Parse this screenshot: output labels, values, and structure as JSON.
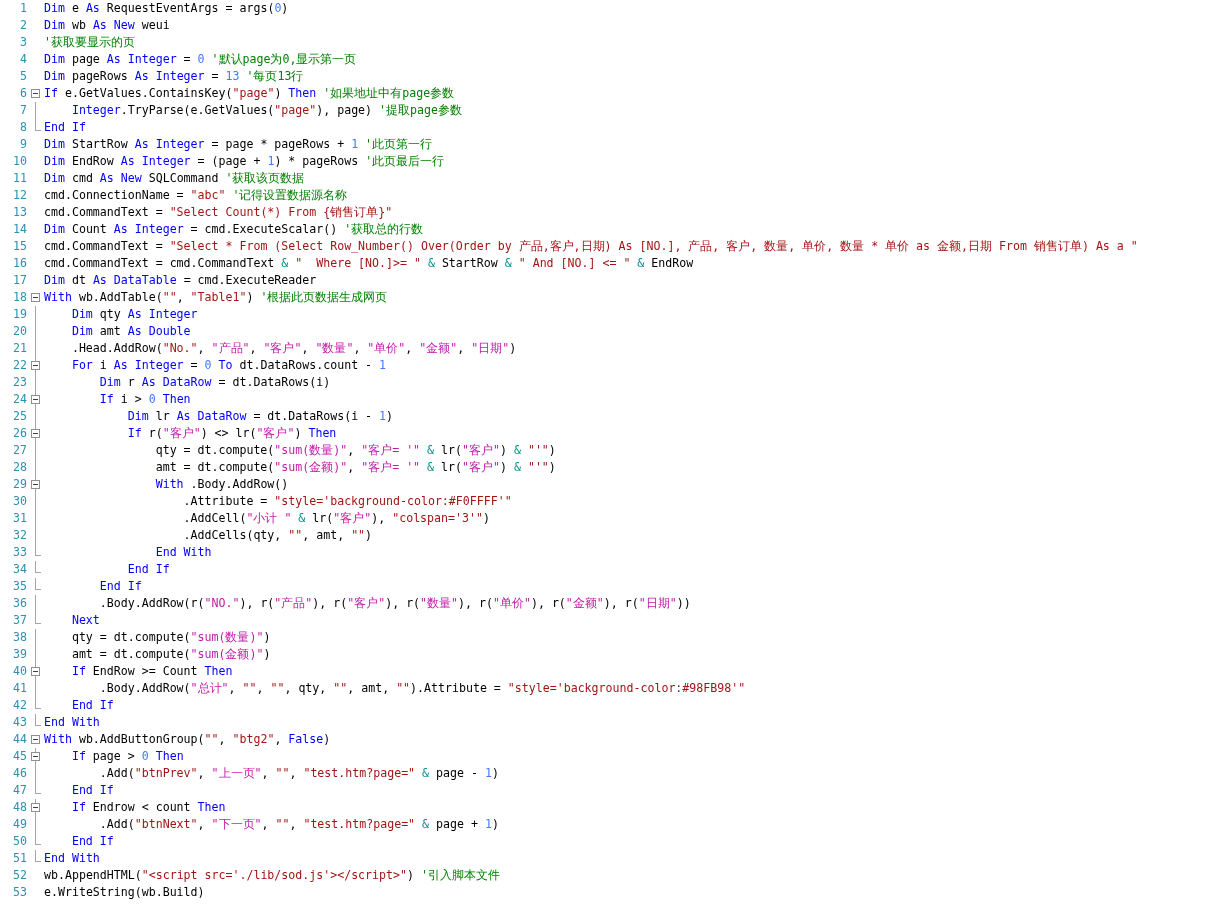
{
  "editor": {
    "lines": [
      {
        "number": "1",
        "tokens": [
          {
            "kind": "keyword",
            "text": "Dim "
          },
          {
            "kind": "plain",
            "text": "e "
          },
          {
            "kind": "keyword",
            "text": "As "
          },
          {
            "kind": "plain",
            "text": "RequestEventArgs = args("
          },
          {
            "kind": "number",
            "text": "0"
          },
          {
            "kind": "plain",
            "text": ")"
          }
        ]
      },
      {
        "number": "2",
        "tokens": [
          {
            "kind": "keyword",
            "text": "Dim "
          },
          {
            "kind": "plain",
            "text": "wb "
          },
          {
            "kind": "keyword",
            "text": "As New "
          },
          {
            "kind": "plain",
            "text": "weui"
          }
        ]
      },
      {
        "number": "3",
        "tokens": [
          {
            "kind": "comment",
            "text": "'获取要显示的页"
          }
        ]
      },
      {
        "number": "4",
        "tokens": [
          {
            "kind": "keyword",
            "text": "Dim "
          },
          {
            "kind": "plain",
            "text": "page "
          },
          {
            "kind": "keyword",
            "text": "As Integer "
          },
          {
            "kind": "plain",
            "text": "= "
          },
          {
            "kind": "number",
            "text": "0 "
          },
          {
            "kind": "comment",
            "text": "'默认page为0,显示第一页"
          }
        ]
      },
      {
        "number": "5",
        "tokens": [
          {
            "kind": "keyword",
            "text": "Dim "
          },
          {
            "kind": "plain",
            "text": "pageRows "
          },
          {
            "kind": "keyword",
            "text": "As Integer "
          },
          {
            "kind": "plain",
            "text": "= "
          },
          {
            "kind": "number",
            "text": "13 "
          },
          {
            "kind": "comment",
            "text": "'每页13行"
          }
        ]
      },
      {
        "number": "6",
        "tokens": [
          {
            "kind": "keyword",
            "text": "If "
          },
          {
            "kind": "plain",
            "text": "e.GetValues.ContainsKey("
          },
          {
            "kind": "string",
            "text": "\"page\""
          },
          {
            "kind": "plain",
            "text": ") "
          },
          {
            "kind": "keyword",
            "text": "Then "
          },
          {
            "kind": "comment",
            "text": "'如果地址中有page参数"
          }
        ],
        "children": [
          {
            "number": "7",
            "tokens": [
              {
                "kind": "keyword",
                "text": "Integer"
              },
              {
                "kind": "plain",
                "text": ".TryParse(e.GetValues("
              },
              {
                "kind": "string",
                "text": "\"page\""
              },
              {
                "kind": "plain",
                "text": "), page) "
              },
              {
                "kind": "comment",
                "text": "'提取page参数"
              }
            ]
          }
        ]
      },
      {
        "number": "8",
        "tokens": [
          {
            "kind": "keyword",
            "text": "End If"
          }
        ]
      },
      {
        "number": "9",
        "tokens": [
          {
            "kind": "keyword",
            "text": "Dim "
          },
          {
            "kind": "plain",
            "text": "StartRow "
          },
          {
            "kind": "keyword",
            "text": "As Integer "
          },
          {
            "kind": "plain",
            "text": "= page * pageRows + "
          },
          {
            "kind": "number",
            "text": "1 "
          },
          {
            "kind": "comment",
            "text": "'此页第一行"
          }
        ]
      },
      {
        "number": "10",
        "tokens": [
          {
            "kind": "keyword",
            "text": "Dim "
          },
          {
            "kind": "plain",
            "text": "EndRow "
          },
          {
            "kind": "keyword",
            "text": "As Integer "
          },
          {
            "kind": "plain",
            "text": "= (page + "
          },
          {
            "kind": "number",
            "text": "1"
          },
          {
            "kind": "plain",
            "text": ") * pageRows "
          },
          {
            "kind": "comment",
            "text": "'此页最后一行"
          }
        ]
      },
      {
        "number": "11",
        "tokens": [
          {
            "kind": "keyword",
            "text": "Dim "
          },
          {
            "kind": "plain",
            "text": "cmd "
          },
          {
            "kind": "keyword",
            "text": "As New "
          },
          {
            "kind": "plain",
            "text": "SQLCommand "
          },
          {
            "kind": "comment",
            "text": "'获取该页数据"
          }
        ]
      },
      {
        "number": "12",
        "tokens": [
          {
            "kind": "plain",
            "text": "cmd.ConnectionName = "
          },
          {
            "kind": "string",
            "text": "\"abc\" "
          },
          {
            "kind": "comment",
            "text": "'记得设置数据源名称"
          }
        ]
      },
      {
        "number": "13",
        "tokens": [
          {
            "kind": "plain",
            "text": "cmd.CommandText = "
          },
          {
            "kind": "string",
            "text": "\"Select Count(*) From {销售订单}\""
          }
        ]
      },
      {
        "number": "14",
        "tokens": [
          {
            "kind": "keyword",
            "text": "Dim "
          },
          {
            "kind": "plain",
            "text": "Count "
          },
          {
            "kind": "keyword",
            "text": "As Integer "
          },
          {
            "kind": "plain",
            "text": "= cmd.ExecuteScalar() "
          },
          {
            "kind": "comment",
            "text": "'获取总的行数"
          }
        ]
      },
      {
        "number": "15",
        "tokens": [
          {
            "kind": "plain",
            "text": "cmd.CommandText = "
          },
          {
            "kind": "string",
            "text": "\"Select * From (Select Row_Number() Over(Order by 产品,客户,日期) As [NO.], 产品, 客户, 数量, 单价, 数量 * 单价 as 金额,日期 From 销售订单) As a \""
          }
        ]
      },
      {
        "number": "16",
        "tokens": [
          {
            "kind": "plain",
            "text": "cmd.CommandText = cmd.CommandText "
          },
          {
            "kind": "operator",
            "text": "& "
          },
          {
            "kind": "string",
            "text": "\"  Where [NO.]>= \" "
          },
          {
            "kind": "operator",
            "text": "& "
          },
          {
            "kind": "plain",
            "text": "StartRow "
          },
          {
            "kind": "operator",
            "text": "& "
          },
          {
            "kind": "string",
            "text": "\" And [NO.] <= \" "
          },
          {
            "kind": "operator",
            "text": "& "
          },
          {
            "kind": "plain",
            "text": "EndRow"
          }
        ]
      },
      {
        "number": "17",
        "tokens": [
          {
            "kind": "keyword",
            "text": "Dim "
          },
          {
            "kind": "plain",
            "text": "dt "
          },
          {
            "kind": "keyword",
            "text": "As DataTable "
          },
          {
            "kind": "plain",
            "text": "= cmd.ExecuteReader"
          }
        ]
      },
      {
        "number": "18",
        "tokens": [
          {
            "kind": "keyword",
            "text": "With "
          },
          {
            "kind": "plain",
            "text": "wb.AddTable("
          },
          {
            "kind": "string",
            "text": "\"\""
          },
          {
            "kind": "plain",
            "text": ", "
          },
          {
            "kind": "string",
            "text": "\"Table1\""
          },
          {
            "kind": "plain",
            "text": ") "
          },
          {
            "kind": "comment",
            "text": "'根据此页数据生成网页"
          }
        ],
        "children": [
          {
            "number": "19",
            "tokens": [
              {
                "kind": "keyword",
                "text": "Dim "
              },
              {
                "kind": "plain",
                "text": "qty "
              },
              {
                "kind": "keyword",
                "text": "As Integer"
              }
            ]
          },
          {
            "number": "20",
            "tokens": [
              {
                "kind": "keyword",
                "text": "Dim "
              },
              {
                "kind": "plain",
                "text": "amt "
              },
              {
                "kind": "keyword",
                "text": "As Double"
              }
            ]
          },
          {
            "number": "21",
            "tokens": [
              {
                "kind": "plain",
                "text": ".Head.AddRow("
              },
              {
                "kind": "string",
                "text": "\"No.\""
              },
              {
                "kind": "plain",
                "text": ", "
              },
              {
                "kind": "literal",
                "text": "\"产品\""
              },
              {
                "kind": "plain",
                "text": ", "
              },
              {
                "kind": "literal",
                "text": "\"客户\""
              },
              {
                "kind": "plain",
                "text": ", "
              },
              {
                "kind": "literal",
                "text": "\"数量\""
              },
              {
                "kind": "plain",
                "text": ", "
              },
              {
                "kind": "literal",
                "text": "\"单价\""
              },
              {
                "kind": "plain",
                "text": ", "
              },
              {
                "kind": "literal",
                "text": "\"金额\""
              },
              {
                "kind": "plain",
                "text": ", "
              },
              {
                "kind": "literal",
                "text": "\"日期\""
              },
              {
                "kind": "plain",
                "text": ")"
              }
            ]
          },
          {
            "number": "22",
            "tokens": [
              {
                "kind": "keyword",
                "text": "For "
              },
              {
                "kind": "plain",
                "text": "i "
              },
              {
                "kind": "keyword",
                "text": "As Integer "
              },
              {
                "kind": "plain",
                "text": "= "
              },
              {
                "kind": "number",
                "text": "0 "
              },
              {
                "kind": "keyword",
                "text": "To "
              },
              {
                "kind": "plain",
                "text": "dt.DataRows.count - "
              },
              {
                "kind": "number",
                "text": "1"
              }
            ],
            "children": [
              {
                "number": "23",
                "tokens": [
                  {
                    "kind": "keyword",
                    "text": "Dim "
                  },
                  {
                    "kind": "plain",
                    "text": "r "
                  },
                  {
                    "kind": "keyword",
                    "text": "As DataRow "
                  },
                  {
                    "kind": "plain",
                    "text": "= dt.DataRows(i)"
                  }
                ]
              },
              {
                "number": "24",
                "tokens": [
                  {
                    "kind": "keyword",
                    "text": "If "
                  },
                  {
                    "kind": "plain",
                    "text": "i > "
                  },
                  {
                    "kind": "number",
                    "text": "0 "
                  },
                  {
                    "kind": "keyword",
                    "text": "Then"
                  }
                ],
                "children": [
                  {
                    "number": "25",
                    "tokens": [
                      {
                        "kind": "keyword",
                        "text": "Dim "
                      },
                      {
                        "kind": "plain",
                        "text": "lr "
                      },
                      {
                        "kind": "keyword",
                        "text": "As DataRow "
                      },
                      {
                        "kind": "plain",
                        "text": "= dt.DataRows(i - "
                      },
                      {
                        "kind": "number",
                        "text": "1"
                      },
                      {
                        "kind": "plain",
                        "text": ")"
                      }
                    ]
                  },
                  {
                    "number": "26",
                    "tokens": [
                      {
                        "kind": "keyword",
                        "text": "If "
                      },
                      {
                        "kind": "plain",
                        "text": "r("
                      },
                      {
                        "kind": "literal",
                        "text": "\"客户\""
                      },
                      {
                        "kind": "plain",
                        "text": ") <> lr("
                      },
                      {
                        "kind": "literal",
                        "text": "\"客户\""
                      },
                      {
                        "kind": "plain",
                        "text": ") "
                      },
                      {
                        "kind": "keyword",
                        "text": "Then"
                      }
                    ],
                    "children": [
                      {
                        "number": "27",
                        "tokens": [
                          {
                            "kind": "plain",
                            "text": "qty = dt.compute("
                          },
                          {
                            "kind": "literal",
                            "text": "\"sum(数量)\""
                          },
                          {
                            "kind": "plain",
                            "text": ", "
                          },
                          {
                            "kind": "literal",
                            "text": "\"客户= '\" "
                          },
                          {
                            "kind": "operator",
                            "text": "& "
                          },
                          {
                            "kind": "plain",
                            "text": "lr("
                          },
                          {
                            "kind": "literal",
                            "text": "\"客户\""
                          },
                          {
                            "kind": "plain",
                            "text": ") "
                          },
                          {
                            "kind": "operator",
                            "text": "& "
                          },
                          {
                            "kind": "string",
                            "text": "\"'\""
                          },
                          {
                            "kind": "plain",
                            "text": ")"
                          }
                        ]
                      },
                      {
                        "number": "28",
                        "tokens": [
                          {
                            "kind": "plain",
                            "text": "amt = dt.compute("
                          },
                          {
                            "kind": "literal",
                            "text": "\"sum(金额)\""
                          },
                          {
                            "kind": "plain",
                            "text": ", "
                          },
                          {
                            "kind": "literal",
                            "text": "\"客户= '\" "
                          },
                          {
                            "kind": "operator",
                            "text": "& "
                          },
                          {
                            "kind": "plain",
                            "text": "lr("
                          },
                          {
                            "kind": "literal",
                            "text": "\"客户\""
                          },
                          {
                            "kind": "plain",
                            "text": ") "
                          },
                          {
                            "kind": "operator",
                            "text": "& "
                          },
                          {
                            "kind": "string",
                            "text": "\"'\""
                          },
                          {
                            "kind": "plain",
                            "text": ")"
                          }
                        ]
                      },
                      {
                        "number": "29",
                        "tokens": [
                          {
                            "kind": "keyword",
                            "text": "With "
                          },
                          {
                            "kind": "plain",
                            "text": ".Body.AddRow()"
                          }
                        ],
                        "children": [
                          {
                            "number": "30",
                            "tokens": [
                              {
                                "kind": "plain",
                                "text": ".Attribute = "
                              },
                              {
                                "kind": "string",
                                "text": "\"style='background-color:#F0FFFF'\""
                              }
                            ]
                          },
                          {
                            "number": "31",
                            "tokens": [
                              {
                                "kind": "plain",
                                "text": ".AddCell("
                              },
                              {
                                "kind": "literal",
                                "text": "\"小计 \" "
                              },
                              {
                                "kind": "operator",
                                "text": "& "
                              },
                              {
                                "kind": "plain",
                                "text": "lr("
                              },
                              {
                                "kind": "literal",
                                "text": "\"客户\""
                              },
                              {
                                "kind": "plain",
                                "text": "), "
                              },
                              {
                                "kind": "string",
                                "text": "\"colspan='3'\""
                              },
                              {
                                "kind": "plain",
                                "text": ")"
                              }
                            ]
                          },
                          {
                            "number": "32",
                            "tokens": [
                              {
                                "kind": "plain",
                                "text": ".AddCells(qty, "
                              },
                              {
                                "kind": "string",
                                "text": "\"\""
                              },
                              {
                                "kind": "plain",
                                "text": ", amt, "
                              },
                              {
                                "kind": "string",
                                "text": "\"\""
                              },
                              {
                                "kind": "plain",
                                "text": ")"
                              }
                            ]
                          }
                        ]
                      },
                      {
                        "number": "33",
                        "tokens": [
                          {
                            "kind": "keyword",
                            "text": "End With"
                          }
                        ]
                      }
                    ]
                  },
                  {
                    "number": "34",
                    "tokens": [
                      {
                        "kind": "keyword",
                        "text": "End If"
                      }
                    ]
                  }
                ]
              },
              {
                "number": "35",
                "tokens": [
                  {
                    "kind": "keyword",
                    "text": "End If"
                  }
                ]
              },
              {
                "number": "36",
                "tokens": [
                  {
                    "kind": "plain",
                    "text": ".Body.AddRow(r("
                  },
                  {
                    "kind": "literal",
                    "text": "\"NO.\""
                  },
                  {
                    "kind": "plain",
                    "text": "), r("
                  },
                  {
                    "kind": "literal",
                    "text": "\"产品\""
                  },
                  {
                    "kind": "plain",
                    "text": "), r("
                  },
                  {
                    "kind": "literal",
                    "text": "\"客户\""
                  },
                  {
                    "kind": "plain",
                    "text": "), r("
                  },
                  {
                    "kind": "literal",
                    "text": "\"数量\""
                  },
                  {
                    "kind": "plain",
                    "text": "), r("
                  },
                  {
                    "kind": "literal",
                    "text": "\"单价\""
                  },
                  {
                    "kind": "plain",
                    "text": "), r("
                  },
                  {
                    "kind": "literal",
                    "text": "\"金额\""
                  },
                  {
                    "kind": "plain",
                    "text": "), r("
                  },
                  {
                    "kind": "literal",
                    "text": "\"日期\""
                  },
                  {
                    "kind": "plain",
                    "text": "))"
                  }
                ]
              }
            ]
          },
          {
            "number": "37",
            "tokens": [
              {
                "kind": "keyword",
                "text": "Next"
              }
            ]
          },
          {
            "number": "38",
            "tokens": [
              {
                "kind": "plain",
                "text": "qty = dt.compute("
              },
              {
                "kind": "literal",
                "text": "\"sum(数量)\""
              },
              {
                "kind": "plain",
                "text": ")"
              }
            ]
          },
          {
            "number": "39",
            "tokens": [
              {
                "kind": "plain",
                "text": "amt = dt.compute("
              },
              {
                "kind": "literal",
                "text": "\"sum(金额)\""
              },
              {
                "kind": "plain",
                "text": ")"
              }
            ]
          },
          {
            "number": "40",
            "tokens": [
              {
                "kind": "keyword",
                "text": "If "
              },
              {
                "kind": "plain",
                "text": "EndRow >= Count "
              },
              {
                "kind": "keyword",
                "text": "Then"
              }
            ],
            "children": [
              {
                "number": "41",
                "tokens": [
                  {
                    "kind": "plain",
                    "text": ".Body.AddRow("
                  },
                  {
                    "kind": "literal",
                    "text": "\"总计\""
                  },
                  {
                    "kind": "plain",
                    "text": ", "
                  },
                  {
                    "kind": "string",
                    "text": "\"\""
                  },
                  {
                    "kind": "plain",
                    "text": ", "
                  },
                  {
                    "kind": "string",
                    "text": "\"\""
                  },
                  {
                    "kind": "plain",
                    "text": ", qty, "
                  },
                  {
                    "kind": "string",
                    "text": "\"\""
                  },
                  {
                    "kind": "plain",
                    "text": ", amt, "
                  },
                  {
                    "kind": "string",
                    "text": "\"\""
                  },
                  {
                    "kind": "plain",
                    "text": ").Attribute = "
                  },
                  {
                    "kind": "string",
                    "text": "\"style='background-color:#98FB98'\""
                  }
                ]
              }
            ]
          },
          {
            "number": "42",
            "tokens": [
              {
                "kind": "keyword",
                "text": "End If"
              }
            ]
          }
        ]
      },
      {
        "number": "43",
        "tokens": [
          {
            "kind": "keyword",
            "text": "End With"
          }
        ]
      },
      {
        "number": "44",
        "tokens": [
          {
            "kind": "keyword",
            "text": "With "
          },
          {
            "kind": "plain",
            "text": "wb.AddButtonGroup("
          },
          {
            "kind": "string",
            "text": "\"\""
          },
          {
            "kind": "plain",
            "text": ", "
          },
          {
            "kind": "string",
            "text": "\"btg2\""
          },
          {
            "kind": "plain",
            "text": ", "
          },
          {
            "kind": "keyword",
            "text": "False"
          },
          {
            "kind": "plain",
            "text": ")"
          }
        ],
        "children": [
          {
            "number": "45",
            "tokens": [
              {
                "kind": "keyword",
                "text": "If "
              },
              {
                "kind": "plain",
                "text": "page > "
              },
              {
                "kind": "number",
                "text": "0 "
              },
              {
                "kind": "keyword",
                "text": "Then"
              }
            ],
            "children": [
              {
                "number": "46",
                "tokens": [
                  {
                    "kind": "plain",
                    "text": ".Add("
                  },
                  {
                    "kind": "string",
                    "text": "\"btnPrev\""
                  },
                  {
                    "kind": "plain",
                    "text": ", "
                  },
                  {
                    "kind": "literal",
                    "text": "\"上一页\""
                  },
                  {
                    "kind": "plain",
                    "text": ", "
                  },
                  {
                    "kind": "string",
                    "text": "\"\""
                  },
                  {
                    "kind": "plain",
                    "text": ", "
                  },
                  {
                    "kind": "string",
                    "text": "\"test.htm?page=\" "
                  },
                  {
                    "kind": "operator",
                    "text": "& "
                  },
                  {
                    "kind": "plain",
                    "text": "page - "
                  },
                  {
                    "kind": "number",
                    "text": "1"
                  },
                  {
                    "kind": "plain",
                    "text": ")"
                  }
                ]
              }
            ]
          },
          {
            "number": "47",
            "tokens": [
              {
                "kind": "keyword",
                "text": "End If"
              }
            ]
          },
          {
            "number": "48",
            "tokens": [
              {
                "kind": "keyword",
                "text": "If "
              },
              {
                "kind": "plain",
                "text": "Endrow < count "
              },
              {
                "kind": "keyword",
                "text": "Then"
              }
            ],
            "children": [
              {
                "number": "49",
                "tokens": [
                  {
                    "kind": "plain",
                    "text": ".Add("
                  },
                  {
                    "kind": "string",
                    "text": "\"btnNext\""
                  },
                  {
                    "kind": "plain",
                    "text": ", "
                  },
                  {
                    "kind": "literal",
                    "text": "\"下一页\""
                  },
                  {
                    "kind": "plain",
                    "text": ", "
                  },
                  {
                    "kind": "string",
                    "text": "\"\""
                  },
                  {
                    "kind": "plain",
                    "text": ", "
                  },
                  {
                    "kind": "string",
                    "text": "\"test.htm?page=\" "
                  },
                  {
                    "kind": "operator",
                    "text": "& "
                  },
                  {
                    "kind": "plain",
                    "text": "page + "
                  },
                  {
                    "kind": "number",
                    "text": "1"
                  },
                  {
                    "kind": "plain",
                    "text": ")"
                  }
                ]
              }
            ]
          },
          {
            "number": "50",
            "tokens": [
              {
                "kind": "keyword",
                "text": "End If"
              }
            ]
          }
        ]
      },
      {
        "number": "51",
        "tokens": [
          {
            "kind": "keyword",
            "text": "End With"
          }
        ]
      },
      {
        "number": "52",
        "tokens": [
          {
            "kind": "plain",
            "text": "wb.AppendHTML("
          },
          {
            "kind": "string",
            "text": "\"<script src='./lib/sod.js'></script>\""
          },
          {
            "kind": "plain",
            "text": ") "
          },
          {
            "kind": "comment",
            "text": "'引入脚本文件"
          }
        ]
      },
      {
        "number": "53",
        "tokens": [
          {
            "kind": "plain",
            "text": "e.WriteString(wb.Build)"
          }
        ]
      }
    ]
  }
}
